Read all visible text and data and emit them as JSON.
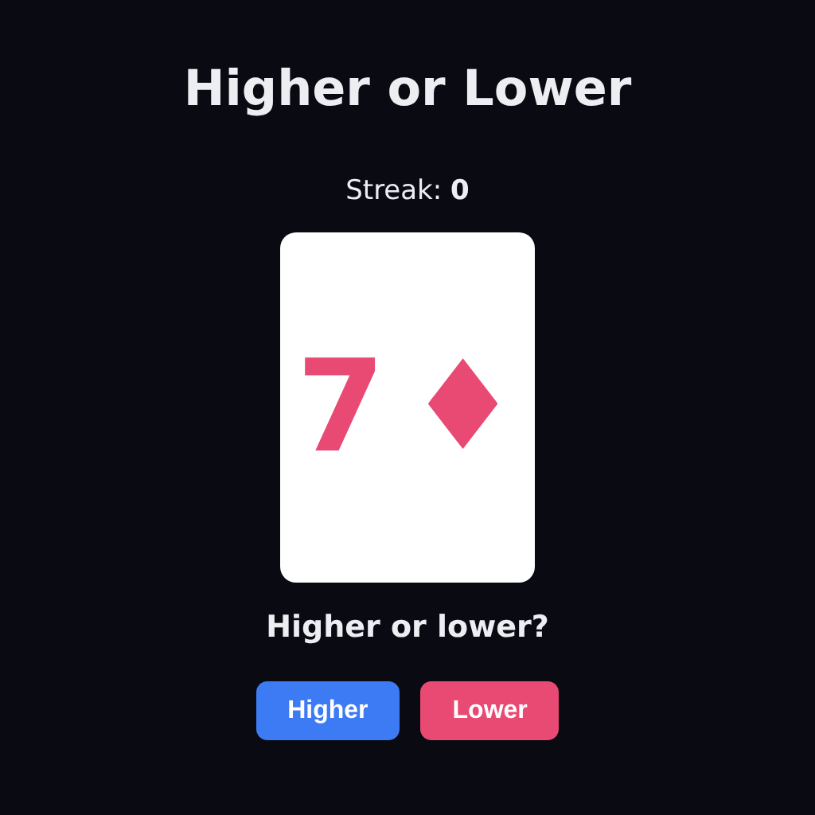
{
  "title": "Higher or Lower",
  "streak": "Streak: **0**",
  "card": {
    "rank": "7",
    "suit": "♦",
    "color": "#e94a73"
  },
  "prompt": "Higher or lower?",
  "buttons": [
    {
      "label": "Higher",
      "kind": "higher"
    },
    {
      "label": "Lower",
      "kind": "lower"
    }
  ]
}
